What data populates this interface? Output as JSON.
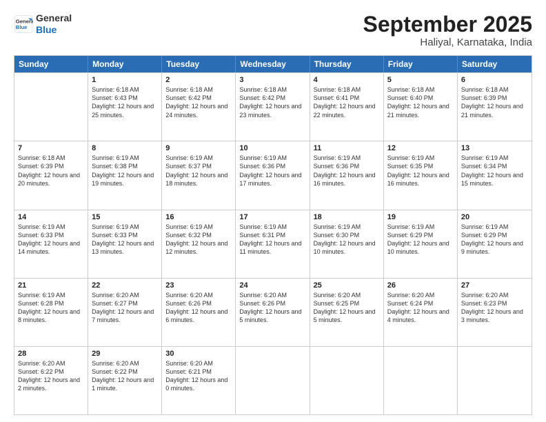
{
  "header": {
    "logo_line1": "General",
    "logo_line2": "Blue",
    "month": "September 2025",
    "location": "Haliyal, Karnataka, India"
  },
  "days_of_week": [
    "Sunday",
    "Monday",
    "Tuesday",
    "Wednesday",
    "Thursday",
    "Friday",
    "Saturday"
  ],
  "weeks": [
    [
      {
        "day": "",
        "empty": true
      },
      {
        "day": "1",
        "sunrise": "6:18 AM",
        "sunset": "6:43 PM",
        "daylight": "12 hours and 25 minutes."
      },
      {
        "day": "2",
        "sunrise": "6:18 AM",
        "sunset": "6:42 PM",
        "daylight": "12 hours and 24 minutes."
      },
      {
        "day": "3",
        "sunrise": "6:18 AM",
        "sunset": "6:42 PM",
        "daylight": "12 hours and 23 minutes."
      },
      {
        "day": "4",
        "sunrise": "6:18 AM",
        "sunset": "6:41 PM",
        "daylight": "12 hours and 22 minutes."
      },
      {
        "day": "5",
        "sunrise": "6:18 AM",
        "sunset": "6:40 PM",
        "daylight": "12 hours and 21 minutes."
      },
      {
        "day": "6",
        "sunrise": "6:18 AM",
        "sunset": "6:39 PM",
        "daylight": "12 hours and 21 minutes."
      }
    ],
    [
      {
        "day": "7",
        "sunrise": "6:18 AM",
        "sunset": "6:39 PM",
        "daylight": "12 hours and 20 minutes."
      },
      {
        "day": "8",
        "sunrise": "6:19 AM",
        "sunset": "6:38 PM",
        "daylight": "12 hours and 19 minutes."
      },
      {
        "day": "9",
        "sunrise": "6:19 AM",
        "sunset": "6:37 PM",
        "daylight": "12 hours and 18 minutes."
      },
      {
        "day": "10",
        "sunrise": "6:19 AM",
        "sunset": "6:36 PM",
        "daylight": "12 hours and 17 minutes."
      },
      {
        "day": "11",
        "sunrise": "6:19 AM",
        "sunset": "6:36 PM",
        "daylight": "12 hours and 16 minutes."
      },
      {
        "day": "12",
        "sunrise": "6:19 AM",
        "sunset": "6:35 PM",
        "daylight": "12 hours and 16 minutes."
      },
      {
        "day": "13",
        "sunrise": "6:19 AM",
        "sunset": "6:34 PM",
        "daylight": "12 hours and 15 minutes."
      }
    ],
    [
      {
        "day": "14",
        "sunrise": "6:19 AM",
        "sunset": "6:33 PM",
        "daylight": "12 hours and 14 minutes."
      },
      {
        "day": "15",
        "sunrise": "6:19 AM",
        "sunset": "6:33 PM",
        "daylight": "12 hours and 13 minutes."
      },
      {
        "day": "16",
        "sunrise": "6:19 AM",
        "sunset": "6:32 PM",
        "daylight": "12 hours and 12 minutes."
      },
      {
        "day": "17",
        "sunrise": "6:19 AM",
        "sunset": "6:31 PM",
        "daylight": "12 hours and 11 minutes."
      },
      {
        "day": "18",
        "sunrise": "6:19 AM",
        "sunset": "6:30 PM",
        "daylight": "12 hours and 10 minutes."
      },
      {
        "day": "19",
        "sunrise": "6:19 AM",
        "sunset": "6:29 PM",
        "daylight": "12 hours and 10 minutes."
      },
      {
        "day": "20",
        "sunrise": "6:19 AM",
        "sunset": "6:29 PM",
        "daylight": "12 hours and 9 minutes."
      }
    ],
    [
      {
        "day": "21",
        "sunrise": "6:19 AM",
        "sunset": "6:28 PM",
        "daylight": "12 hours and 8 minutes."
      },
      {
        "day": "22",
        "sunrise": "6:20 AM",
        "sunset": "6:27 PM",
        "daylight": "12 hours and 7 minutes."
      },
      {
        "day": "23",
        "sunrise": "6:20 AM",
        "sunset": "6:26 PM",
        "daylight": "12 hours and 6 minutes."
      },
      {
        "day": "24",
        "sunrise": "6:20 AM",
        "sunset": "6:26 PM",
        "daylight": "12 hours and 5 minutes."
      },
      {
        "day": "25",
        "sunrise": "6:20 AM",
        "sunset": "6:25 PM",
        "daylight": "12 hours and 5 minutes."
      },
      {
        "day": "26",
        "sunrise": "6:20 AM",
        "sunset": "6:24 PM",
        "daylight": "12 hours and 4 minutes."
      },
      {
        "day": "27",
        "sunrise": "6:20 AM",
        "sunset": "6:23 PM",
        "daylight": "12 hours and 3 minutes."
      }
    ],
    [
      {
        "day": "28",
        "sunrise": "6:20 AM",
        "sunset": "6:22 PM",
        "daylight": "12 hours and 2 minutes."
      },
      {
        "day": "29",
        "sunrise": "6:20 AM",
        "sunset": "6:22 PM",
        "daylight": "12 hours and 1 minute."
      },
      {
        "day": "30",
        "sunrise": "6:20 AM",
        "sunset": "6:21 PM",
        "daylight": "12 hours and 0 minutes."
      },
      {
        "day": "",
        "empty": true
      },
      {
        "day": "",
        "empty": true
      },
      {
        "day": "",
        "empty": true
      },
      {
        "day": "",
        "empty": true
      }
    ]
  ]
}
